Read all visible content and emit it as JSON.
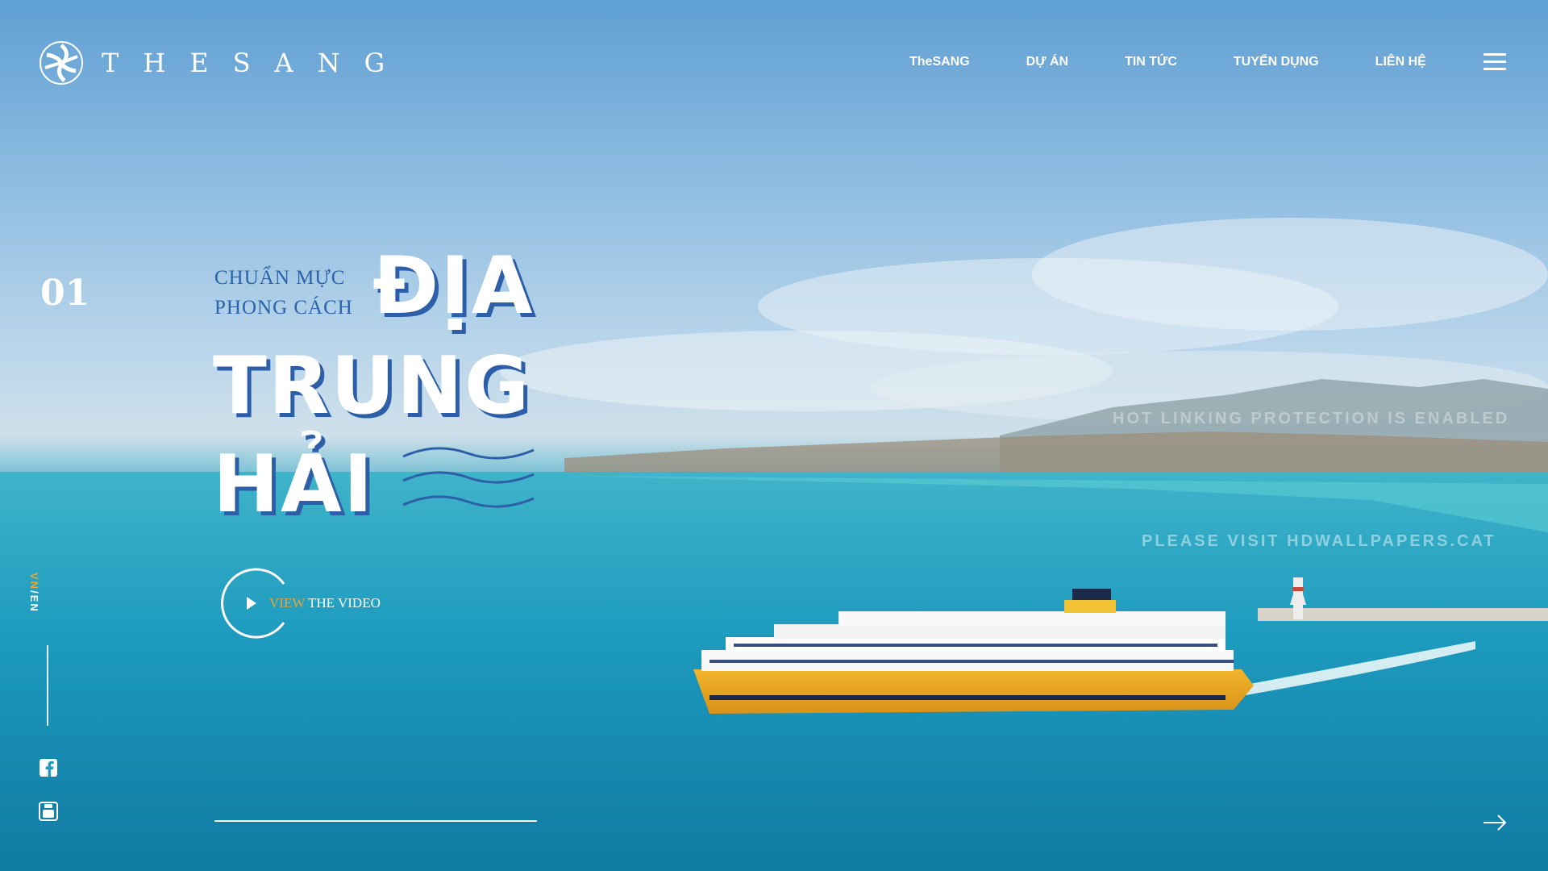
{
  "brand": {
    "name": "THESANG",
    "logo_icon": "swirl-logo-icon"
  },
  "nav": {
    "items": [
      {
        "label": "TheSANG"
      },
      {
        "label": "DỰ ÁN"
      },
      {
        "label": "TIN TỨC"
      },
      {
        "label": "TUYỂN DỤNG"
      },
      {
        "label": "LIÊN HỆ"
      }
    ],
    "menu_icon": "hamburger-menu-icon"
  },
  "slide": {
    "number": "01",
    "subheading_line1": "CHUẨN MỰC",
    "subheading_line2": "PHONG CÁCH",
    "headline_word1": "ĐỊA",
    "headline_word2": "TRUNG",
    "headline_word3": "HẢI",
    "progress": 1.0
  },
  "video": {
    "label_accent": "VIEW",
    "label_rest": " THE VIDEO",
    "icon": "play-icon"
  },
  "language": {
    "vn": "VN",
    "separator": "/",
    "en": "EN"
  },
  "social": {
    "facebook_icon": "facebook-icon",
    "youtube_icon": "youtube-icon"
  },
  "watermark": {
    "line1": "HOT LINKING PROTECTION IS ENABLED",
    "line2": "PLEASE VISIT HDWALLPAPERS.CAT"
  },
  "colors": {
    "accent": "#e8a53a",
    "headline_shadow": "#2d5ea8",
    "subheading": "#2a63a8"
  }
}
